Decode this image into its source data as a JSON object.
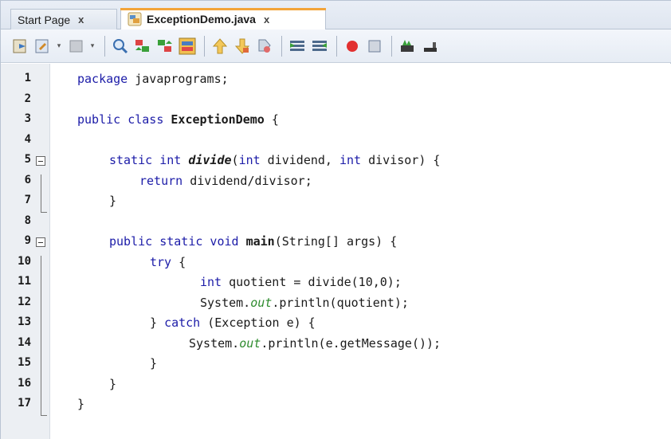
{
  "tabs": [
    {
      "label": "Start Page",
      "close": "x",
      "active": false
    },
    {
      "label": "ExceptionDemo.java",
      "close": "x",
      "active": true
    }
  ],
  "toolbar": {
    "icons": [
      "go-to-source-icon",
      "last-edit-icon",
      "back-icon",
      "forward-icon",
      "find-icon",
      "find-previous-icon",
      "find-next-icon",
      "toggle-highlight-icon",
      "previous-bookmark-icon",
      "next-bookmark-icon",
      "toggle-bookmark-icon",
      "shift-left-icon",
      "shift-right-icon",
      "record-macro-icon",
      "stop-macro-icon",
      "start-recording-icon",
      "comment-icon"
    ]
  },
  "editor": {
    "lines": [
      {
        "n": "1",
        "text": "package javaprograms;"
      },
      {
        "n": "2",
        "text": ""
      },
      {
        "n": "3",
        "text": "public class ExceptionDemo {"
      },
      {
        "n": "4",
        "text": ""
      },
      {
        "n": "5",
        "text": "static int divide(int dividend, int divisor) {"
      },
      {
        "n": "6",
        "text": "return dividend/divisor;"
      },
      {
        "n": "7",
        "text": "}"
      },
      {
        "n": "8",
        "text": ""
      },
      {
        "n": "9",
        "text": "public static void main(String[] args) {"
      },
      {
        "n": "10",
        "text": "try {"
      },
      {
        "n": "11",
        "text": "int quotient = divide(10,0);"
      },
      {
        "n": "12",
        "text": "System.out.println(quotient);"
      },
      {
        "n": "13",
        "text": "} catch (Exception e) {"
      },
      {
        "n": "14",
        "text": "System.out.println(e.getMessage());"
      },
      {
        "n": "15",
        "text": "}"
      },
      {
        "n": "16",
        "text": "}"
      },
      {
        "n": "17",
        "text": "}"
      }
    ]
  },
  "colors": {
    "keyword": "#1c1ca8",
    "field": "#2e8b2e",
    "tab_accent": "#f3a43a",
    "gutter": "#eceff3"
  }
}
